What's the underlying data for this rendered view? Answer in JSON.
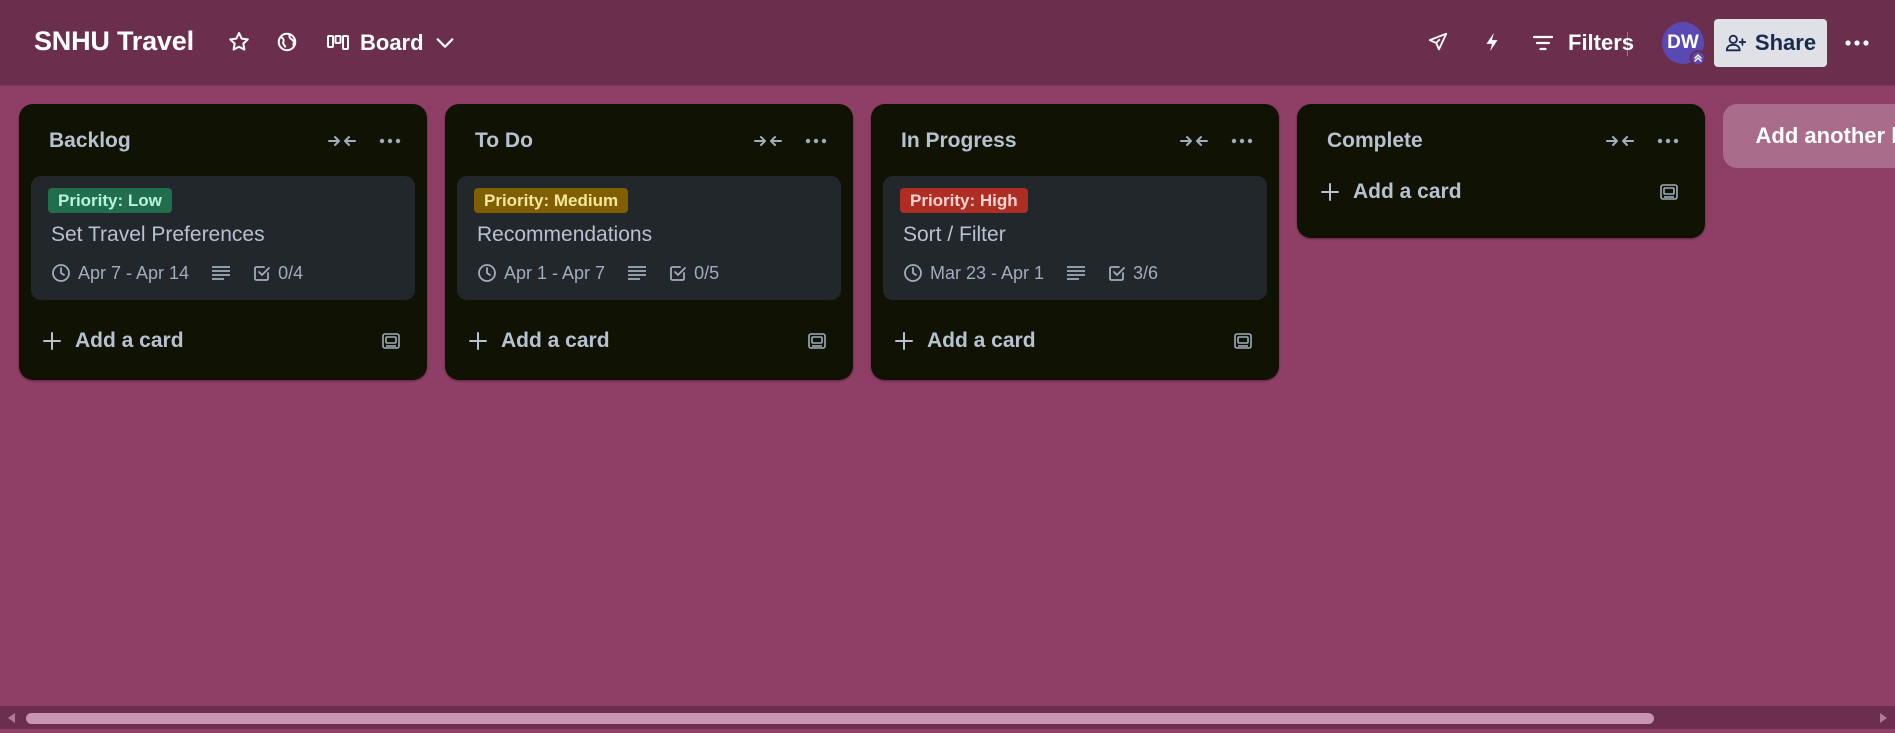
{
  "header": {
    "board_title": "SNHU Travel",
    "view_label": "Board",
    "filters_label": "Filters",
    "avatar_initials": "DW",
    "share_label": "Share"
  },
  "lists": [
    {
      "title": "Backlog",
      "cards": [
        {
          "label": "Priority: Low",
          "label_color": "#216e4e",
          "label_text_color": "#baf3db",
          "title": "Set Travel Preferences",
          "dates": "Apr 7 - Apr 14",
          "checklist": "0/4"
        }
      ],
      "add_card_label": "Add a card"
    },
    {
      "title": "To Do",
      "cards": [
        {
          "label": "Priority: Medium",
          "label_color": "#7f5f01",
          "label_text_color": "#f8e6a0",
          "title": "Recommendations",
          "dates": "Apr 1 - Apr 7",
          "checklist": "0/5"
        }
      ],
      "add_card_label": "Add a card"
    },
    {
      "title": "In Progress",
      "cards": [
        {
          "label": "Priority: High",
          "label_color": "#ae2e24",
          "label_text_color": "#ffd5d2",
          "title": "Sort / Filter",
          "dates": "Mar 23 - Apr 1",
          "checklist": "3/6"
        }
      ],
      "add_card_label": "Add a card"
    },
    {
      "title": "Complete",
      "cards": [],
      "add_card_label": "Add a card"
    }
  ],
  "add_list_label": "Add another list",
  "icons": {
    "star": "star-icon",
    "globe": "globe-icon",
    "board_view": "board-icon",
    "chevron": "chevron-down-icon",
    "rocket": "power-ups-icon",
    "bolt": "automation-icon",
    "filter": "filter-icon",
    "share": "add-person-icon",
    "more": "more-icon",
    "collapse": "collapse-icon",
    "clock": "clock-icon",
    "description": "description-icon",
    "checklist": "checklist-icon",
    "plus": "plus-icon",
    "template": "template-icon"
  },
  "colors": {
    "board_bg": "#8f3f66",
    "header_bg": "#6b2e4c",
    "list_bg": "#101204",
    "card_bg": "#22272b",
    "text": "#b6c2cf"
  }
}
